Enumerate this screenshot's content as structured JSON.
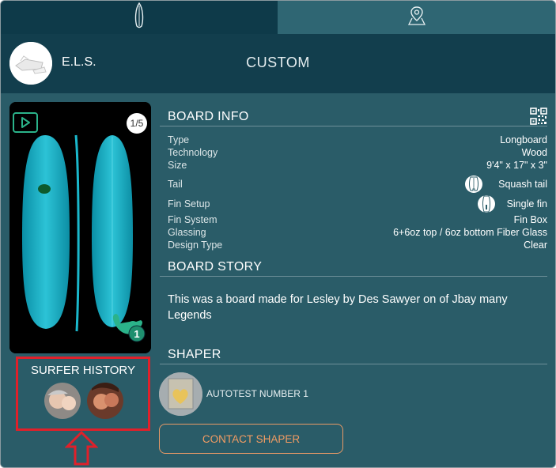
{
  "tabs": [
    {
      "name": "board",
      "icon": "surfboard-icon"
    },
    {
      "name": "map",
      "icon": "map-pin-icon"
    }
  ],
  "header": {
    "brand_name": "E.L.S.",
    "title": "CUSTOM"
  },
  "gallery": {
    "counter": "1/5",
    "shaka_count": "1",
    "colors": {
      "board": "#1fb2c6",
      "background": "#000000"
    }
  },
  "surfer_history": {
    "title": "SURFER HISTORY"
  },
  "board_info": {
    "title": "BOARD INFO",
    "rows": [
      {
        "label": "Type",
        "value": "Longboard"
      },
      {
        "label": "Technology",
        "value": "Wood"
      },
      {
        "label": "Size",
        "value": "9'4\" x 17\" x 3\""
      },
      {
        "label": "Tail",
        "value": "Squash tail"
      },
      {
        "label": "Fin Setup",
        "value": "Single fin"
      },
      {
        "label": "Fin System",
        "value": "Fin Box"
      },
      {
        "label": "Glassing",
        "value": "6+6oz top / 6oz bottom Fiber Glass"
      },
      {
        "label": "Design Type",
        "value": "Clear"
      }
    ]
  },
  "board_story": {
    "title": "BOARD STORY",
    "text": "This was a board made for Lesley by Des Sawyer on of Jbay many Legends"
  },
  "shaper": {
    "title": "SHAPER",
    "name": "AUTOTEST NUMBER 1",
    "contact_label": "CONTACT SHAPER"
  },
  "colors": {
    "accent": "#f29c63",
    "highlight": "#e0202a",
    "panel": "#2a5c68",
    "header": "#123e4d",
    "play": "#2bb38a"
  }
}
